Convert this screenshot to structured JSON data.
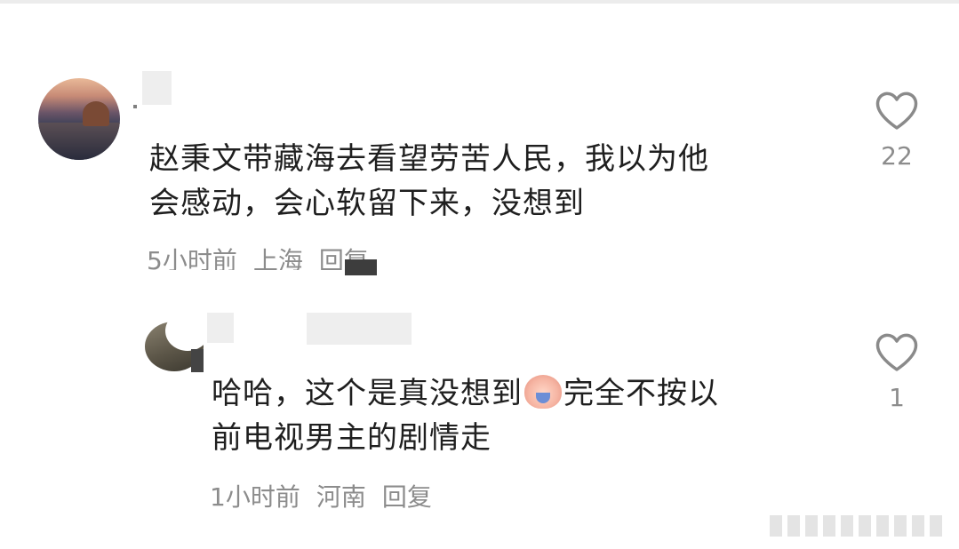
{
  "comments": [
    {
      "avatar": "user-avatar-cathedral-skyline",
      "text_line1": "赵秉文带藏海去看望劳苦人民，我以为他",
      "text_line2": "会感动，会心软留下来，没想到",
      "time": "5小时前",
      "location": "上海",
      "reply_label": "回复",
      "like_icon": "heart-outline-icon",
      "like_count": "22"
    },
    {
      "avatar": "user-avatar-landscape",
      "text_part1": "哈哈，这个是真没想到",
      "emoji": "crying-face-emoji",
      "text_part2": "完全不按以",
      "text_line2": "前电视男主的剧情走",
      "time": "1小时前",
      "location": "河南",
      "reply_label": "回复",
      "like_icon": "heart-outline-icon",
      "like_count": "1"
    }
  ],
  "colors": {
    "text_primary": "#1f1f1f",
    "text_secondary": "#8c8c8c",
    "icon_stroke": "#8a8a8a",
    "redaction": "#eeeeee"
  }
}
